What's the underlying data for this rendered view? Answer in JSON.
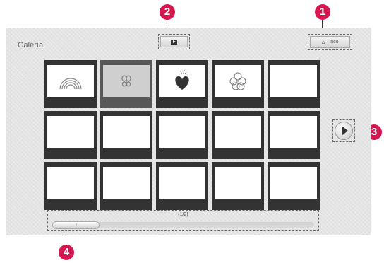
{
  "gallery": {
    "title": "Galería",
    "home_label": "Inco",
    "home_icon": "home-icon",
    "play_icon": "play-icon",
    "next_icon": "next-arrow-icon",
    "page_indicator": "(1/2)",
    "scroll_handle": "III",
    "scroll_position": 0.18,
    "thumbnails": [
      {
        "content": "rainbow"
      },
      {
        "content": "butterfly",
        "selected": true
      },
      {
        "content": "heart"
      },
      {
        "content": "flower"
      },
      {
        "content": "empty"
      },
      {
        "content": "empty"
      },
      {
        "content": "empty"
      },
      {
        "content": "empty"
      },
      {
        "content": "empty"
      },
      {
        "content": "empty"
      },
      {
        "content": "empty"
      },
      {
        "content": "empty"
      },
      {
        "content": "empty"
      },
      {
        "content": "empty"
      },
      {
        "content": "empty"
      }
    ]
  },
  "callouts": [
    "1",
    "2",
    "3",
    "4"
  ],
  "colors": {
    "callout": "#d6164f",
    "panel": "#e4e4e4",
    "thumb_frame": "#333333"
  }
}
